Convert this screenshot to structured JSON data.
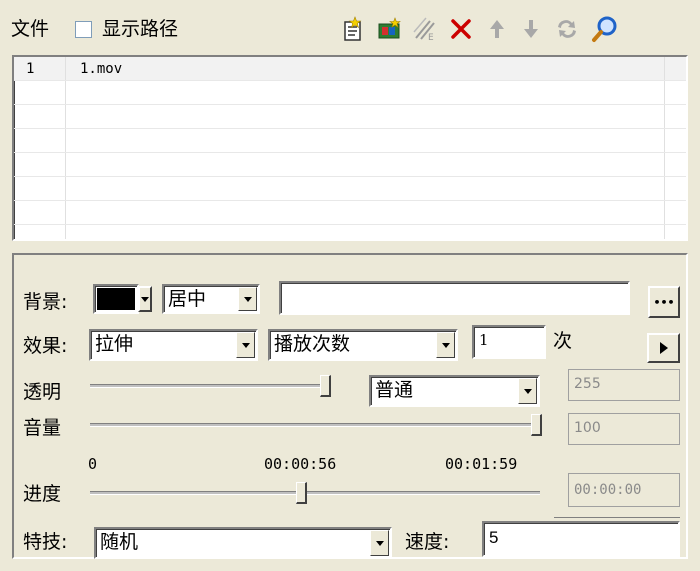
{
  "top": {
    "file_label": "文件",
    "show_path_label": "显示路径",
    "show_path_checked": false,
    "toolbar_icons": [
      "add-file-icon",
      "add-folder-icon",
      "edit-icon",
      "delete-icon",
      "move-up-icon",
      "move-down-icon",
      "swap-icon",
      "search-icon"
    ],
    "icon_colors": {
      "delete": "#cc0000",
      "arrows": "#888888",
      "search": "#1f63c8",
      "folder": "#d4b400"
    }
  },
  "file_list": {
    "rows": [
      {
        "index": "1",
        "name": "1.mov"
      }
    ]
  },
  "settings": {
    "background_label": "背景:",
    "background_color": "#000000",
    "align_value": "居中",
    "background_path_value": "",
    "browse_label": "•••",
    "effect_label": "效果:",
    "effect_value": "拉伸",
    "play_count_label": "播放次数",
    "play_count_value": "1",
    "times_label": "次",
    "transparency_label": "透明",
    "transparency_value": 255,
    "transparency_display": "255",
    "blend_mode_value": "普通",
    "volume_label": "音量",
    "volume_value": 100,
    "volume_display": "100",
    "time_start": "0",
    "time_current": "00:00:56",
    "time_end": "00:01:59",
    "progress_fraction": 0.47,
    "progress_label": "进度",
    "progress_display": "00:00:00",
    "transition_label": "特技:",
    "transition_value": "随机",
    "speed_label": "速度:",
    "speed_value": "5"
  }
}
